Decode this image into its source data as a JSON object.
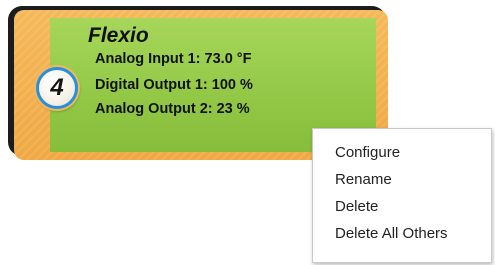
{
  "device": {
    "name": "Flexio",
    "badge_number": "4",
    "readings": [
      {
        "label": "Analog Input 1: 73.0 °F"
      },
      {
        "label": "Digital Output 1: 100 %"
      },
      {
        "label": "Analog Output 2: 23 %"
      }
    ],
    "colors": {
      "frame": "#f0a844",
      "panel": "#94c948",
      "badge_ring": "#2a8ee0"
    }
  },
  "context_menu": {
    "items": [
      {
        "label": "Configure"
      },
      {
        "label": "Rename"
      },
      {
        "label": "Delete"
      },
      {
        "label": "Delete All Others"
      }
    ]
  }
}
